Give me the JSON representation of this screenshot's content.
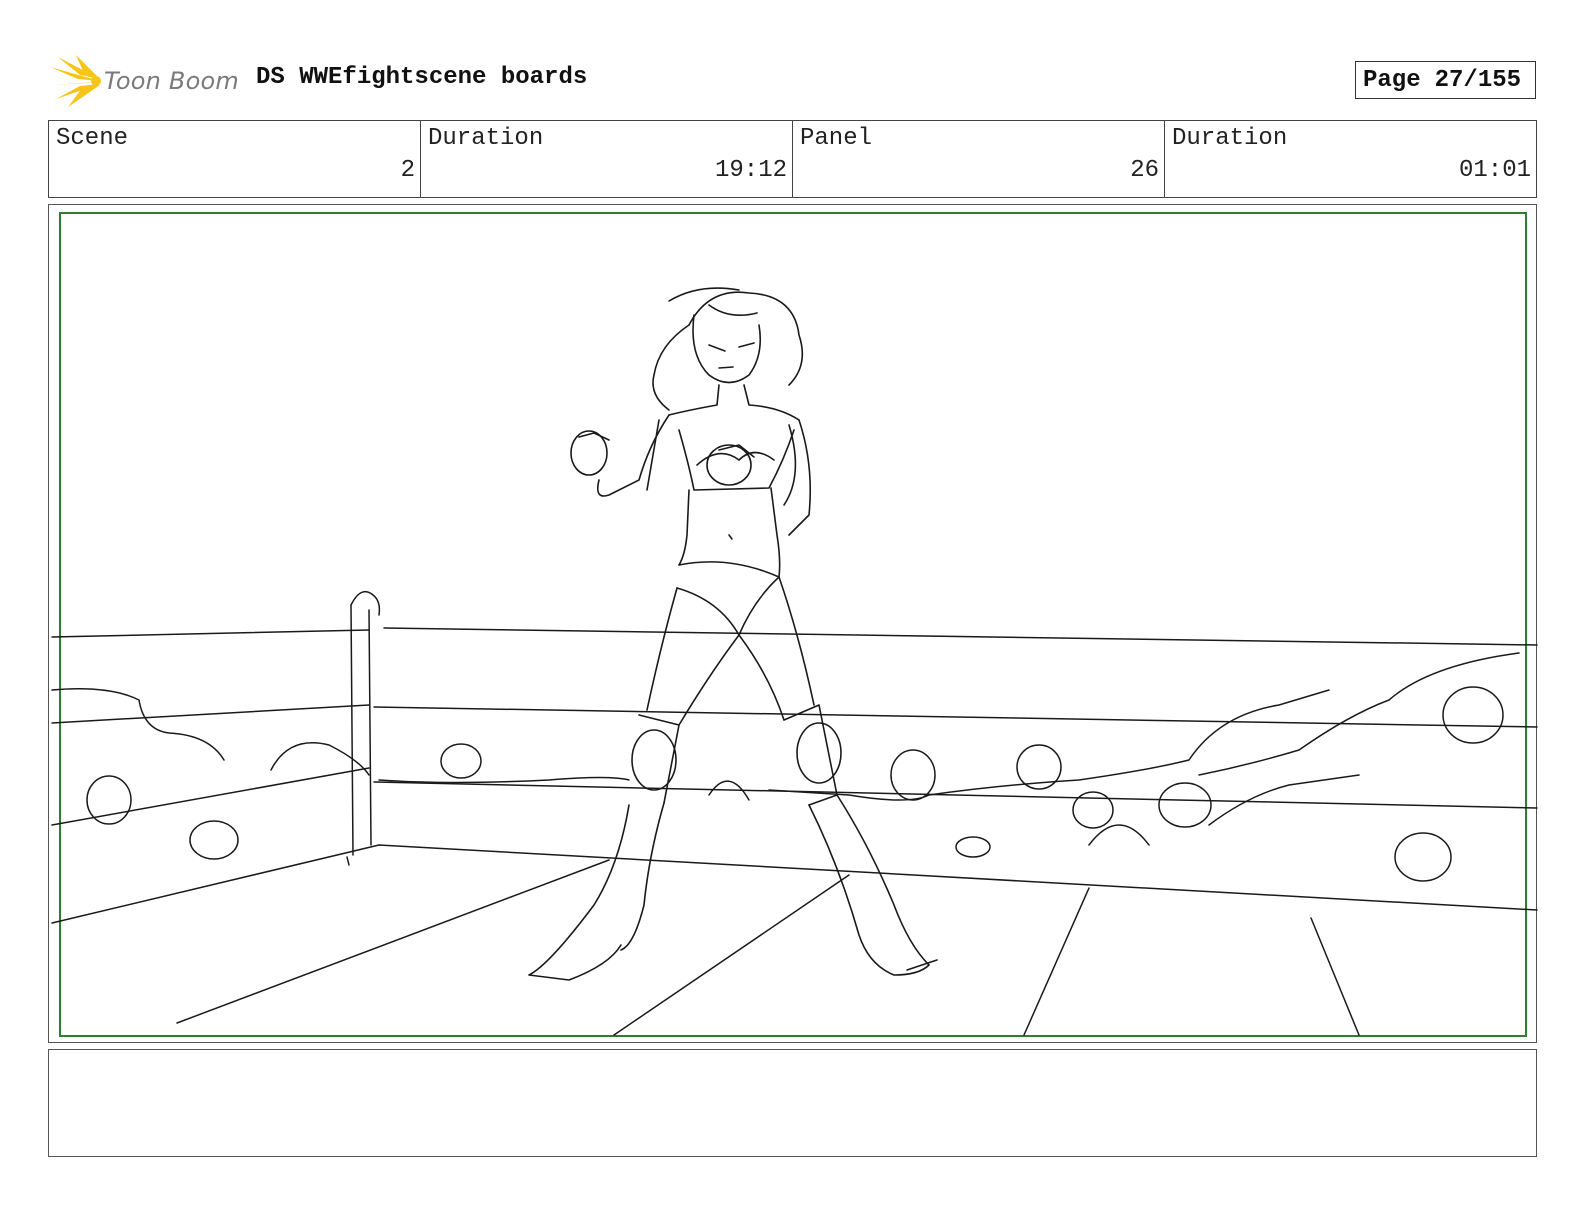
{
  "header": {
    "logo_text": "Toon Boom",
    "logo_icon": "starburst-logo-icon",
    "title": "DS WWEfightscene boards",
    "page_label": "Page",
    "page_value": "27/155"
  },
  "info": {
    "scene_label": "Scene",
    "scene_value": "2",
    "scene_duration_label": "Duration",
    "scene_duration_value": "19:12",
    "panel_label": "Panel",
    "panel_value": "26",
    "panel_duration_label": "Duration",
    "panel_duration_value": "01:01"
  },
  "colors": {
    "frame_border": "#2e7d32",
    "logo_yellow": "#f5c518",
    "sketch_stroke": "#1a1a1a"
  }
}
